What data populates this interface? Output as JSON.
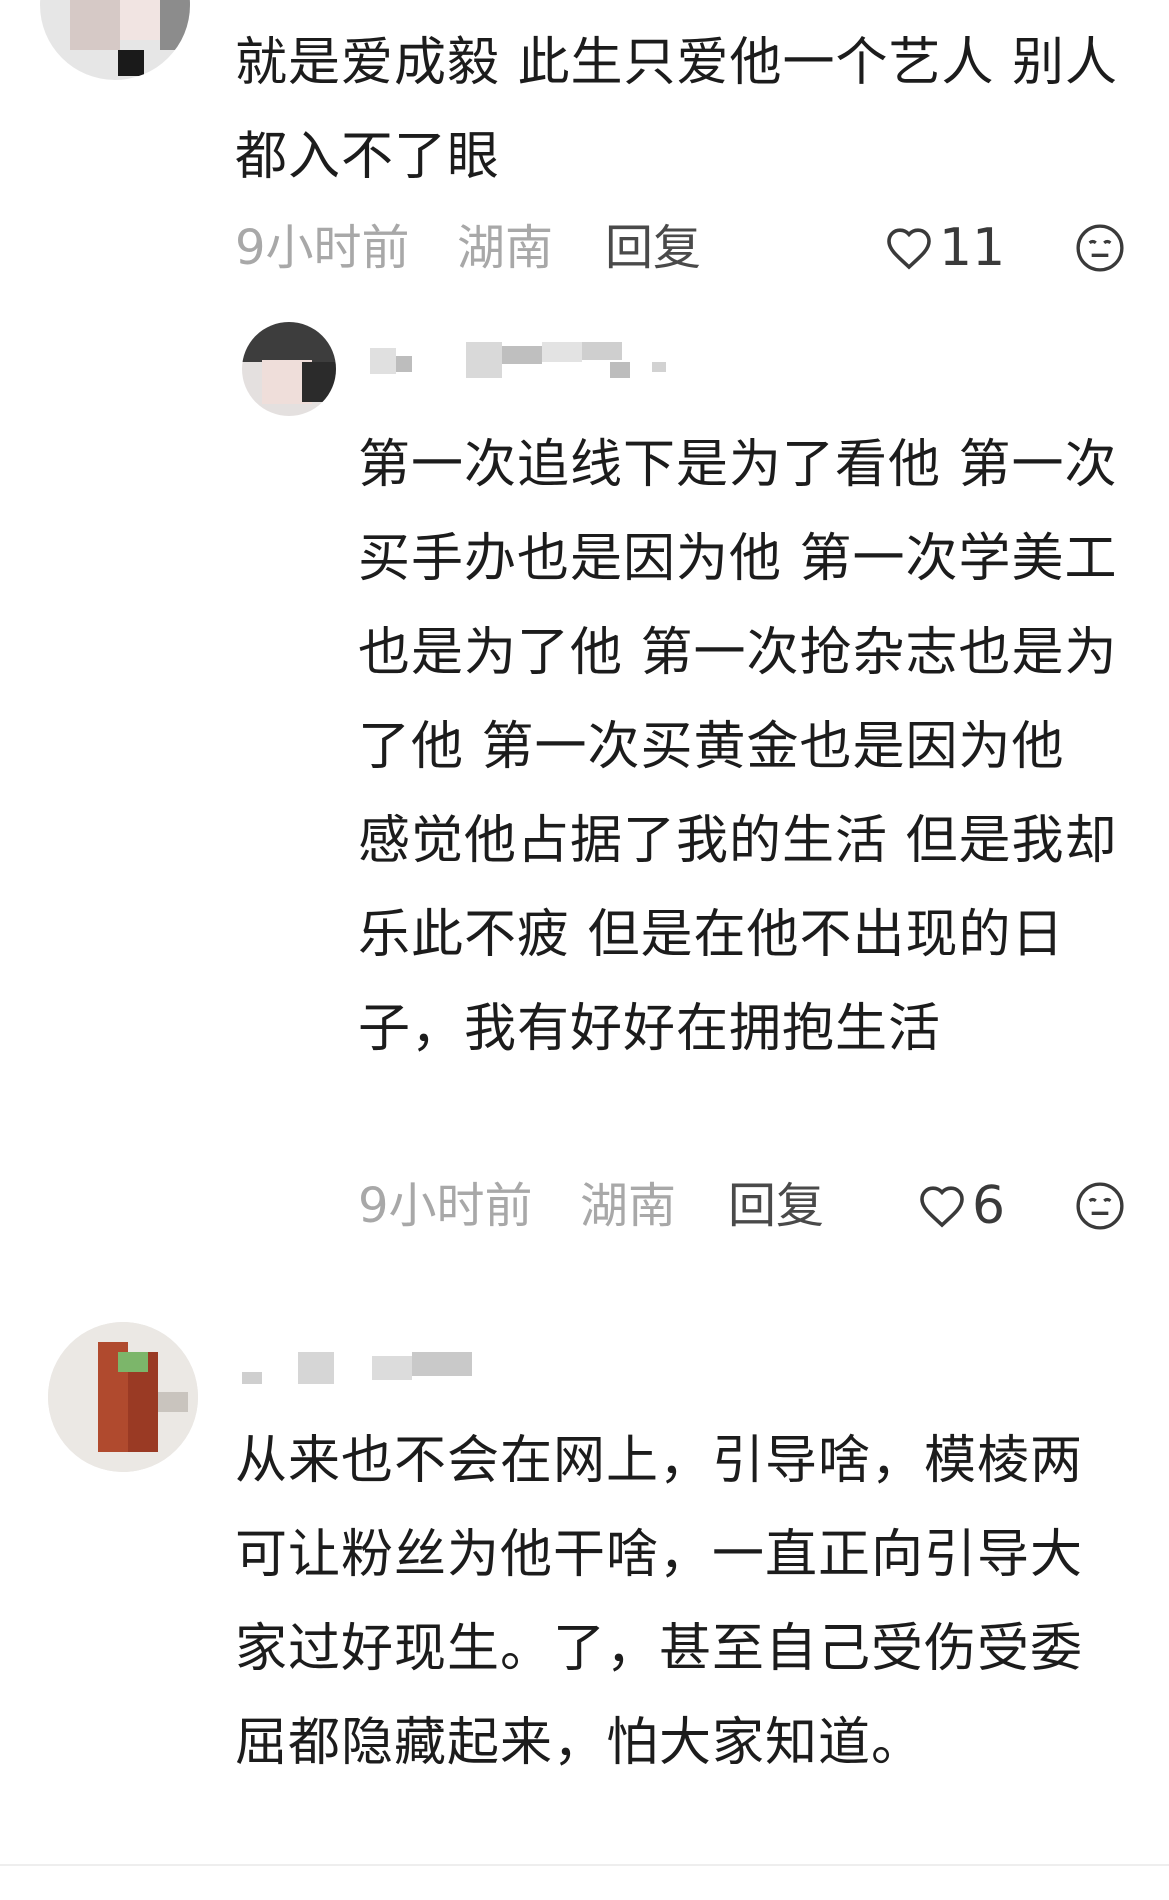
{
  "comments": [
    {
      "text": "就是爱成毅 此生只爱他一个艺人 别人都入不了眼",
      "time": "9小时前",
      "location": "湖南",
      "reply_label": "回复",
      "likes": "11"
    },
    {
      "text": "第一次追线下是为了看他 第一次买手办也是因为他  第一次学美工也是为了他 第一次抢杂志也是为了他 第一次买黄金也是因为他 感觉他占据了我的生活 但是我却乐此不疲 但是在他不出现的日子，我有好好在拥抱生活",
      "time": "9小时前",
      "location": "湖南",
      "reply_label": "回复",
      "likes": "6"
    },
    {
      "text": "从来也不会在网上，引导啥，模棱两可让粉丝为他干啥，一直正向引导大家过好现生。了，甚至自己受伤受委屈都隐藏起来，怕大家知道。"
    }
  ],
  "icons": {
    "like": "heart-outline-icon",
    "emoji": "neutral-face-icon"
  },
  "colors": {
    "meta_gray": "#a8a8a8",
    "reply_gray": "#4a4a4a",
    "text": "#1c1c1c"
  }
}
